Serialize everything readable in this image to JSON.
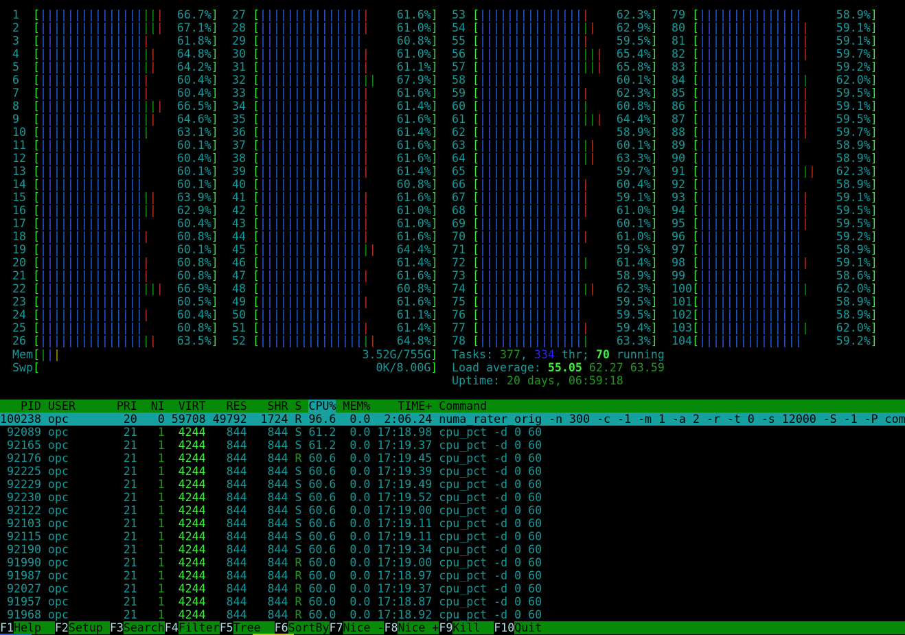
{
  "colors": {
    "text": "#139a9a",
    "header_bg": "#078a07",
    "selected_bg": "#16a0a0",
    "bar_blue": "#2a5ee0",
    "bar_green": "#139a13",
    "bar_red": "#c03222"
  },
  "cpus": [
    {
      "n": "1",
      "pct": "66.7%",
      "extra": "ggr"
    },
    {
      "n": "2",
      "pct": "67.1%",
      "extra": "ggr"
    },
    {
      "n": "3",
      "pct": "61.8%",
      "extra": "r"
    },
    {
      "n": "4",
      "pct": "64.8%",
      "extra": "gr"
    },
    {
      "n": "5",
      "pct": "64.2%",
      "extra": "gr"
    },
    {
      "n": "6",
      "pct": "60.4%",
      "extra": "r"
    },
    {
      "n": "7",
      "pct": "60.4%",
      "extra": "r"
    },
    {
      "n": "8",
      "pct": "66.5%",
      "extra": "ggr"
    },
    {
      "n": "9",
      "pct": "64.6%",
      "extra": "gr"
    },
    {
      "n": "10",
      "pct": "63.1%",
      "extra": "g"
    },
    {
      "n": "11",
      "pct": "60.1%",
      "extra": ""
    },
    {
      "n": "12",
      "pct": "60.4%",
      "extra": ""
    },
    {
      "n": "13",
      "pct": "60.1%",
      "extra": ""
    },
    {
      "n": "14",
      "pct": "60.1%",
      "extra": ""
    },
    {
      "n": "15",
      "pct": "63.9%",
      "extra": "gr"
    },
    {
      "n": "16",
      "pct": "62.9%",
      "extra": "gr"
    },
    {
      "n": "17",
      "pct": "60.4%",
      "extra": ""
    },
    {
      "n": "18",
      "pct": "60.8%",
      "extra": "r"
    },
    {
      "n": "19",
      "pct": "60.1%",
      "extra": ""
    },
    {
      "n": "20",
      "pct": "60.8%",
      "extra": "r"
    },
    {
      "n": "21",
      "pct": "60.8%",
      "extra": "r"
    },
    {
      "n": "22",
      "pct": "66.9%",
      "extra": "ggr"
    },
    {
      "n": "23",
      "pct": "60.5%",
      "extra": ""
    },
    {
      "n": "24",
      "pct": "60.4%",
      "extra": "r"
    },
    {
      "n": "25",
      "pct": "60.8%",
      "extra": ""
    },
    {
      "n": "26",
      "pct": "63.5%",
      "extra": "gr"
    },
    {
      "n": "27",
      "pct": "61.6%",
      "extra": "r"
    },
    {
      "n": "28",
      "pct": "61.0%",
      "extra": "r"
    },
    {
      "n": "29",
      "pct": "60.8%",
      "extra": ""
    },
    {
      "n": "30",
      "pct": "61.0%",
      "extra": "r"
    },
    {
      "n": "31",
      "pct": "61.1%",
      "extra": "r"
    },
    {
      "n": "32",
      "pct": "67.9%",
      "extra": "gg"
    },
    {
      "n": "33",
      "pct": "61.6%",
      "extra": "r"
    },
    {
      "n": "34",
      "pct": "61.4%",
      "extra": "r"
    },
    {
      "n": "35",
      "pct": "61.6%",
      "extra": "r"
    },
    {
      "n": "36",
      "pct": "61.4%",
      "extra": "r"
    },
    {
      "n": "37",
      "pct": "61.6%",
      "extra": "r"
    },
    {
      "n": "38",
      "pct": "61.6%",
      "extra": "r"
    },
    {
      "n": "39",
      "pct": "61.4%",
      "extra": "r"
    },
    {
      "n": "40",
      "pct": "60.8%",
      "extra": ""
    },
    {
      "n": "41",
      "pct": "61.6%",
      "extra": "r"
    },
    {
      "n": "42",
      "pct": "61.0%",
      "extra": "r"
    },
    {
      "n": "43",
      "pct": "61.0%",
      "extra": "r"
    },
    {
      "n": "44",
      "pct": "61.6%",
      "extra": "r"
    },
    {
      "n": "45",
      "pct": "64.4%",
      "extra": "gr"
    },
    {
      "n": "46",
      "pct": "61.4%",
      "extra": ""
    },
    {
      "n": "47",
      "pct": "61.6%",
      "extra": "r"
    },
    {
      "n": "48",
      "pct": "60.8%",
      "extra": ""
    },
    {
      "n": "49",
      "pct": "61.6%",
      "extra": "r"
    },
    {
      "n": "50",
      "pct": "61.1%",
      "extra": ""
    },
    {
      "n": "51",
      "pct": "61.4%",
      "extra": "r"
    },
    {
      "n": "52",
      "pct": "64.8%",
      "extra": "gr"
    },
    {
      "n": "53",
      "pct": "62.3%",
      "extra": "r"
    },
    {
      "n": "54",
      "pct": "62.9%",
      "extra": "gr"
    },
    {
      "n": "55",
      "pct": "59.5%",
      "extra": "r"
    },
    {
      "n": "56",
      "pct": "65.4%",
      "extra": "ggr"
    },
    {
      "n": "57",
      "pct": "65.8%",
      "extra": "ggr"
    },
    {
      "n": "58",
      "pct": "60.1%",
      "extra": ""
    },
    {
      "n": "59",
      "pct": "62.3%",
      "extra": "r"
    },
    {
      "n": "60",
      "pct": "60.8%",
      "extra": "g"
    },
    {
      "n": "61",
      "pct": "64.4%",
      "extra": "ggr"
    },
    {
      "n": "62",
      "pct": "58.9%",
      "extra": ""
    },
    {
      "n": "63",
      "pct": "60.1%",
      "extra": "gr"
    },
    {
      "n": "64",
      "pct": "63.3%",
      "extra": "gr"
    },
    {
      "n": "65",
      "pct": "59.7%",
      "extra": ""
    },
    {
      "n": "66",
      "pct": "60.4%",
      "extra": "r"
    },
    {
      "n": "67",
      "pct": "59.1%",
      "extra": "r"
    },
    {
      "n": "68",
      "pct": "61.0%",
      "extra": "r"
    },
    {
      "n": "69",
      "pct": "60.1%",
      "extra": ""
    },
    {
      "n": "70",
      "pct": "61.0%",
      "extra": "r"
    },
    {
      "n": "71",
      "pct": "59.5%",
      "extra": ""
    },
    {
      "n": "72",
      "pct": "61.4%",
      "extra": "g"
    },
    {
      "n": "73",
      "pct": "58.9%",
      "extra": ""
    },
    {
      "n": "74",
      "pct": "62.3%",
      "extra": "gr"
    },
    {
      "n": "75",
      "pct": "59.5%",
      "extra": ""
    },
    {
      "n": "76",
      "pct": "59.5%",
      "extra": ""
    },
    {
      "n": "77",
      "pct": "59.4%",
      "extra": "r"
    },
    {
      "n": "78",
      "pct": "63.3%",
      "extra": "g"
    },
    {
      "n": "79",
      "pct": "58.9%",
      "extra": ""
    },
    {
      "n": "80",
      "pct": "59.1%",
      "extra": "r"
    },
    {
      "n": "81",
      "pct": "59.1%",
      "extra": "r"
    },
    {
      "n": "82",
      "pct": "59.7%",
      "extra": "r"
    },
    {
      "n": "83",
      "pct": "59.2%",
      "extra": ""
    },
    {
      "n": "84",
      "pct": "62.0%",
      "extra": "g"
    },
    {
      "n": "85",
      "pct": "59.5%",
      "extra": "r"
    },
    {
      "n": "86",
      "pct": "59.1%",
      "extra": "r"
    },
    {
      "n": "87",
      "pct": "59.5%",
      "extra": "r"
    },
    {
      "n": "88",
      "pct": "59.7%",
      "extra": "r"
    },
    {
      "n": "89",
      "pct": "58.9%",
      "extra": ""
    },
    {
      "n": "90",
      "pct": "58.9%",
      "extra": ""
    },
    {
      "n": "91",
      "pct": "62.3%",
      "extra": "gr"
    },
    {
      "n": "92",
      "pct": "58.9%",
      "extra": ""
    },
    {
      "n": "93",
      "pct": "59.1%",
      "extra": "r"
    },
    {
      "n": "94",
      "pct": "59.5%",
      "extra": "r"
    },
    {
      "n": "95",
      "pct": "59.5%",
      "extra": "r"
    },
    {
      "n": "96",
      "pct": "59.2%",
      "extra": ""
    },
    {
      "n": "97",
      "pct": "58.9%",
      "extra": ""
    },
    {
      "n": "98",
      "pct": "59.1%",
      "extra": "r"
    },
    {
      "n": "99",
      "pct": "58.6%",
      "extra": ""
    },
    {
      "n": "100",
      "pct": "62.0%",
      "extra": "g"
    },
    {
      "n": "101",
      "pct": "58.9%",
      "extra": ""
    },
    {
      "n": "102",
      "pct": "58.9%",
      "extra": ""
    },
    {
      "n": "103",
      "pct": "62.0%",
      "extra": "g"
    },
    {
      "n": "104",
      "pct": "59.2%",
      "extra": ""
    }
  ],
  "mem": {
    "label": "Mem",
    "value": "3.52G/755G"
  },
  "swp": {
    "label": "Swp",
    "value": "0K/8.00G"
  },
  "tasks": {
    "label": "Tasks: ",
    "count": "377",
    "sep": ", ",
    "threads": "334",
    "thr_label": " thr; ",
    "running": "70",
    "running_label": " running"
  },
  "load": {
    "label": "Load average: ",
    "l1": "55.05",
    "l5": "62.27",
    "l15": "63.59"
  },
  "uptime": {
    "label": "Uptime: ",
    "value": "20 days, 06:59:18"
  },
  "columns": [
    "PID",
    "USER",
    "PRI",
    "NI",
    "VIRT",
    "RES",
    "SHR",
    "S",
    "CPU%",
    "MEM%",
    "TIME+",
    "Command"
  ],
  "processes": [
    {
      "pid": "100238",
      "user": "opc",
      "pri": "20",
      "ni": "0",
      "virt": "59708",
      "res": "49792",
      "shr": "1724",
      "s": "R",
      "cpu": "96.6",
      "mem": "0.0",
      "time": "2:06.24",
      "cmd": "numa_rater_orig -n 300 -c -1 -m 1 -a 2 -r -t 0 -s 12000 -S -1 -P com"
    },
    {
      "pid": "92089",
      "user": "opc",
      "pri": "21",
      "ni": "1",
      "virt": "4244",
      "res": "844",
      "shr": "844",
      "s": "S",
      "cpu": "61.2",
      "mem": "0.0",
      "time": "17:18.98",
      "cmd": "cpu_pct -d 0 60"
    },
    {
      "pid": "92165",
      "user": "opc",
      "pri": "21",
      "ni": "1",
      "virt": "4244",
      "res": "844",
      "shr": "844",
      "s": "S",
      "cpu": "61.2",
      "mem": "0.0",
      "time": "17:19.37",
      "cmd": "cpu_pct -d 0 60"
    },
    {
      "pid": "92176",
      "user": "opc",
      "pri": "21",
      "ni": "1",
      "virt": "4244",
      "res": "844",
      "shr": "844",
      "s": "R",
      "cpu": "60.6",
      "mem": "0.0",
      "time": "17:19.45",
      "cmd": "cpu_pct -d 0 60"
    },
    {
      "pid": "92225",
      "user": "opc",
      "pri": "21",
      "ni": "1",
      "virt": "4244",
      "res": "844",
      "shr": "844",
      "s": "S",
      "cpu": "60.6",
      "mem": "0.0",
      "time": "17:19.39",
      "cmd": "cpu_pct -d 0 60"
    },
    {
      "pid": "92229",
      "user": "opc",
      "pri": "21",
      "ni": "1",
      "virt": "4244",
      "res": "844",
      "shr": "844",
      "s": "S",
      "cpu": "60.6",
      "mem": "0.0",
      "time": "17:19.49",
      "cmd": "cpu_pct -d 0 60"
    },
    {
      "pid": "92230",
      "user": "opc",
      "pri": "21",
      "ni": "1",
      "virt": "4244",
      "res": "844",
      "shr": "844",
      "s": "S",
      "cpu": "60.6",
      "mem": "0.0",
      "time": "17:19.52",
      "cmd": "cpu_pct -d 0 60"
    },
    {
      "pid": "92122",
      "user": "opc",
      "pri": "21",
      "ni": "1",
      "virt": "4244",
      "res": "844",
      "shr": "844",
      "s": "S",
      "cpu": "60.6",
      "mem": "0.0",
      "time": "17:19.00",
      "cmd": "cpu_pct -d 0 60"
    },
    {
      "pid": "92103",
      "user": "opc",
      "pri": "21",
      "ni": "1",
      "virt": "4244",
      "res": "844",
      "shr": "844",
      "s": "S",
      "cpu": "60.6",
      "mem": "0.0",
      "time": "17:19.11",
      "cmd": "cpu_pct -d 0 60"
    },
    {
      "pid": "92115",
      "user": "opc",
      "pri": "21",
      "ni": "1",
      "virt": "4244",
      "res": "844",
      "shr": "844",
      "s": "S",
      "cpu": "60.6",
      "mem": "0.0",
      "time": "17:19.11",
      "cmd": "cpu_pct -d 0 60"
    },
    {
      "pid": "92190",
      "user": "opc",
      "pri": "21",
      "ni": "1",
      "virt": "4244",
      "res": "844",
      "shr": "844",
      "s": "S",
      "cpu": "60.6",
      "mem": "0.0",
      "time": "17:19.34",
      "cmd": "cpu_pct -d 0 60"
    },
    {
      "pid": "91990",
      "user": "opc",
      "pri": "21",
      "ni": "1",
      "virt": "4244",
      "res": "844",
      "shr": "844",
      "s": "R",
      "cpu": "60.0",
      "mem": "0.0",
      "time": "17:19.00",
      "cmd": "cpu_pct -d 0 60"
    },
    {
      "pid": "91987",
      "user": "opc",
      "pri": "21",
      "ni": "1",
      "virt": "4244",
      "res": "844",
      "shr": "844",
      "s": "R",
      "cpu": "60.0",
      "mem": "0.0",
      "time": "17:18.97",
      "cmd": "cpu_pct -d 0 60"
    },
    {
      "pid": "92027",
      "user": "opc",
      "pri": "21",
      "ni": "1",
      "virt": "4244",
      "res": "844",
      "shr": "844",
      "s": "R",
      "cpu": "60.0",
      "mem": "0.0",
      "time": "17:19.37",
      "cmd": "cpu_pct -d 0 60"
    },
    {
      "pid": "91957",
      "user": "opc",
      "pri": "21",
      "ni": "1",
      "virt": "4244",
      "res": "844",
      "shr": "844",
      "s": "R",
      "cpu": "60.0",
      "mem": "0.0",
      "time": "17:18.87",
      "cmd": "cpu_pct -d 0 60"
    },
    {
      "pid": "91968",
      "user": "opc",
      "pri": "21",
      "ni": "1",
      "virt": "4244",
      "res": "844",
      "shr": "844",
      "s": "R",
      "cpu": "60.0",
      "mem": "0.0",
      "time": "17:18.92",
      "cmd": "cpu_pct -d 0 60"
    }
  ],
  "footer": [
    {
      "key": "F1",
      "label": "Help"
    },
    {
      "key": "F2",
      "label": "Setup"
    },
    {
      "key": "F3",
      "label": "Search"
    },
    {
      "key": "F4",
      "label": "Filter"
    },
    {
      "key": "F5",
      "label": "Tree"
    },
    {
      "key": "F6",
      "label": "SortBy"
    },
    {
      "key": "F7",
      "label": "Nice -"
    },
    {
      "key": "F8",
      "label": "Nice +"
    },
    {
      "key": "F9",
      "label": "Kill"
    },
    {
      "key": "F10",
      "label": "Quit"
    }
  ]
}
